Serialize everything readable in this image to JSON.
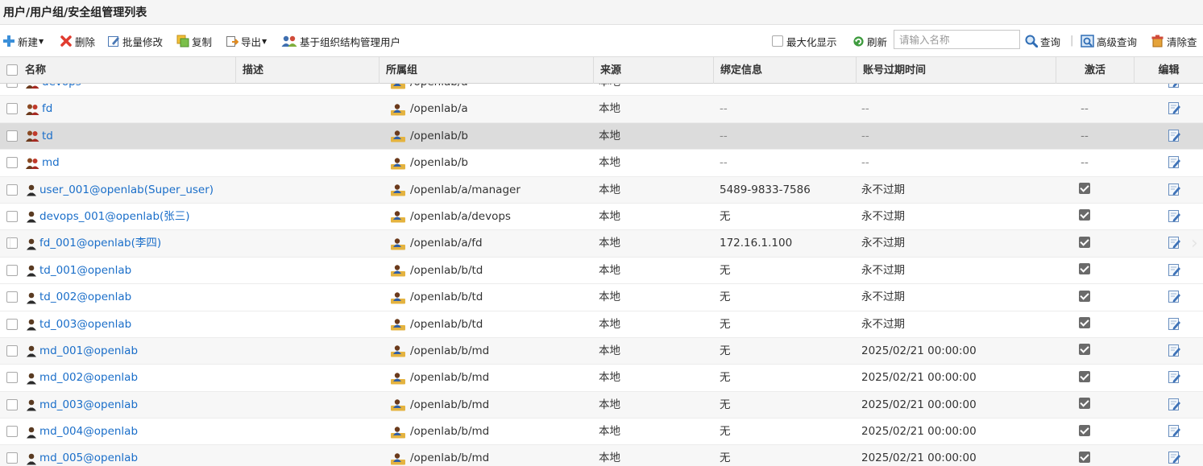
{
  "page": {
    "title": "用户/用户组/安全组管理列表"
  },
  "toolbar": {
    "new_label": "新建",
    "delete_label": "删除",
    "batch_edit_label": "批量修改",
    "copy_label": "复制",
    "export_label": "导出",
    "org_manage_label": "基于组织结构管理用户",
    "maximize_label": "最大化显示",
    "refresh_label": "刷新",
    "search_placeholder": "请输入名称",
    "query_label": "查询",
    "separator": "|",
    "advanced_query_label": "高级查询",
    "clear_query_label": "清除查"
  },
  "table": {
    "columns": [
      "名称",
      "描述",
      "所属组",
      "来源",
      "绑定信息",
      "账号过期时间",
      "激活",
      "编辑"
    ],
    "rows": [
      {
        "name": "devops",
        "type": "group",
        "group": "/openlab/a",
        "source": "本地",
        "binding": "--",
        "expire": "--",
        "active": "--",
        "style": "normal"
      },
      {
        "name": "fd",
        "type": "group",
        "group": "/openlab/a",
        "source": "本地",
        "binding": "--",
        "expire": "--",
        "active": "--",
        "style": "alt"
      },
      {
        "name": "td",
        "type": "group",
        "group": "/openlab/b",
        "source": "本地",
        "binding": "--",
        "expire": "--",
        "active": "--",
        "style": "sel"
      },
      {
        "name": "md",
        "type": "group",
        "group": "/openlab/b",
        "source": "本地",
        "binding": "--",
        "expire": "--",
        "active": "--",
        "style": "normal"
      },
      {
        "name": "user_001@openlab(Super_user)",
        "type": "user",
        "group": "/openlab/a/manager",
        "source": "本地",
        "binding": "5489-9833-7586",
        "expire": "永不过期",
        "active": true,
        "style": "alt"
      },
      {
        "name": "devops_001@openlab(张三)",
        "type": "user",
        "group": "/openlab/a/devops",
        "source": "本地",
        "binding": "无",
        "expire": "永不过期",
        "active": true,
        "style": "normal"
      },
      {
        "name": "fd_001@openlab(李四)",
        "type": "user",
        "group": "/openlab/a/fd",
        "source": "本地",
        "binding": "172.16.1.100",
        "expire": "永不过期",
        "active": true,
        "style": "alt"
      },
      {
        "name": "td_001@openlab",
        "type": "user",
        "group": "/openlab/b/td",
        "source": "本地",
        "binding": "无",
        "expire": "永不过期",
        "active": true,
        "style": "normal"
      },
      {
        "name": "td_002@openlab",
        "type": "user",
        "group": "/openlab/b/td",
        "source": "本地",
        "binding": "无",
        "expire": "永不过期",
        "active": true,
        "style": "normal"
      },
      {
        "name": "td_003@openlab",
        "type": "user",
        "group": "/openlab/b/td",
        "source": "本地",
        "binding": "无",
        "expire": "永不过期",
        "active": true,
        "style": "normal"
      },
      {
        "name": "md_001@openlab",
        "type": "user",
        "group": "/openlab/b/md",
        "source": "本地",
        "binding": "无",
        "expire": "2025/02/21 00:00:00",
        "active": true,
        "style": "alt"
      },
      {
        "name": "md_002@openlab",
        "type": "user",
        "group": "/openlab/b/md",
        "source": "本地",
        "binding": "无",
        "expire": "2025/02/21 00:00:00",
        "active": true,
        "style": "normal"
      },
      {
        "name": "md_003@openlab",
        "type": "user",
        "group": "/openlab/b/md",
        "source": "本地",
        "binding": "无",
        "expire": "2025/02/21 00:00:00",
        "active": true,
        "style": "alt"
      },
      {
        "name": "md_004@openlab",
        "type": "user",
        "group": "/openlab/b/md",
        "source": "本地",
        "binding": "无",
        "expire": "2025/02/21 00:00:00",
        "active": true,
        "style": "normal"
      },
      {
        "name": "md_005@openlab",
        "type": "user",
        "group": "/openlab/b/md",
        "source": "本地",
        "binding": "无",
        "expire": "2025/02/21 00:00:00",
        "active": true,
        "style": "alt"
      }
    ]
  },
  "colors": {
    "link": "#1a6ec9",
    "header_bg": "#f2f2f2",
    "selected_row": "#dcdcdc",
    "alt_row": "#f7f7f7"
  }
}
